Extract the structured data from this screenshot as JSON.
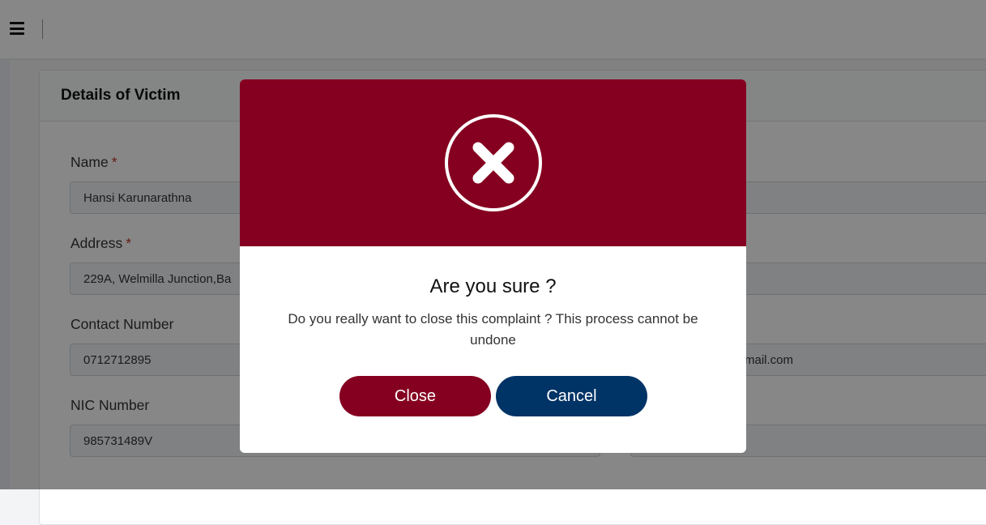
{
  "header": {
    "menu_icon": "hamburger-menu-icon"
  },
  "card": {
    "title": "Details of Victim",
    "required_marker": "*",
    "fields": {
      "name": {
        "label": "Name",
        "value": "Hansi Karunarathna"
      },
      "address": {
        "label": "Address",
        "value": "229A, Welmilla Junction,Ba"
      },
      "contact": {
        "label": "Contact Number",
        "value": "0712712895"
      },
      "nic": {
        "label": "NIC Number",
        "value": "985731489V"
      },
      "email_partial": {
        "value": "mail.com"
      }
    }
  },
  "modal": {
    "icon": "close-x-icon",
    "title": "Are you sure ?",
    "message": "Do you really want to close this complaint ? This process cannot be undone",
    "close_label": "Close",
    "cancel_label": "Cancel",
    "colors": {
      "header_bg": "#850020",
      "close_btn": "#850020",
      "cancel_btn": "#003366"
    }
  }
}
